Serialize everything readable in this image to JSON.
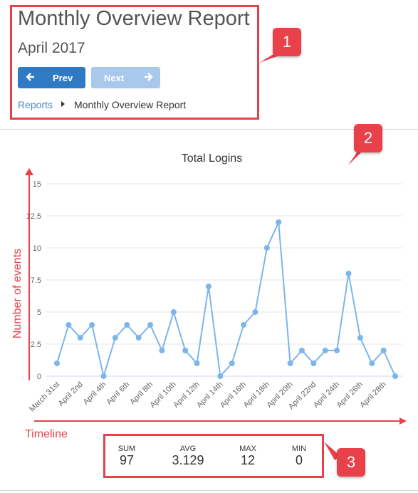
{
  "header": {
    "title": "Monthly Overview Report",
    "subtitle": "April 2017",
    "prev_label": "Prev",
    "next_label": "Next"
  },
  "breadcrumb": {
    "root": "Reports",
    "current": "Monthly Overview Report"
  },
  "annotations": {
    "callout_1": "1",
    "callout_2": "2",
    "callout_3": "3",
    "y_axis_note": "Number of events",
    "x_axis_note": "Timeline"
  },
  "chart_data": {
    "type": "line",
    "title": "Total Logins",
    "xlabel": "",
    "ylabel": "",
    "ylim": [
      0,
      15
    ],
    "yticks": [
      "0",
      "2.5",
      "5",
      "7.5",
      "10",
      "12.5",
      "15"
    ],
    "ytick_values": [
      0,
      2.5,
      5,
      7.5,
      10,
      12.5,
      15
    ],
    "x": [
      "March 31st",
      "April 1st",
      "April 2nd",
      "April 3rd",
      "April 4th",
      "April 5th",
      "April 6th",
      "April 7th",
      "April 8th",
      "April 9th",
      "April 10th",
      "April 11th",
      "April 12th",
      "April 13th",
      "April 14th",
      "April 15th",
      "April 16th",
      "April 17th",
      "April 18th",
      "April 19th",
      "April 20th",
      "April 21st",
      "April 22nd",
      "April 23rd",
      "April 24th",
      "April 25th",
      "April 26th",
      "April 27th",
      "April 28th",
      "April 29th"
    ],
    "xtick_labels": [
      "March 31st",
      "April 2nd",
      "April 4th",
      "April 6th",
      "April 8th",
      "April 10th",
      "April 12th",
      "April 14th",
      "April 16th",
      "April 18th",
      "April 20th",
      "April 22nd",
      "April 24th",
      "April 26th",
      "April 28th"
    ],
    "values": [
      1,
      4,
      3,
      4,
      0,
      3,
      4,
      3,
      4,
      2,
      5,
      2,
      1,
      7,
      0,
      1,
      4,
      5,
      10,
      12,
      1,
      2,
      1,
      2,
      2,
      8,
      3,
      1,
      2,
      0
    ],
    "grid": true,
    "line_color": "#7cb5ec"
  },
  "stats": [
    {
      "label": "SUM",
      "value": "97"
    },
    {
      "label": "AVG",
      "value": "3.129"
    },
    {
      "label": "MAX",
      "value": "12"
    },
    {
      "label": "MIN",
      "value": "0"
    }
  ],
  "colors": {
    "annotation_red": "#e8414a",
    "primary_button": "#2f7ac4",
    "disabled_button": "#a8c9ec",
    "link": "#4a8ac8"
  }
}
